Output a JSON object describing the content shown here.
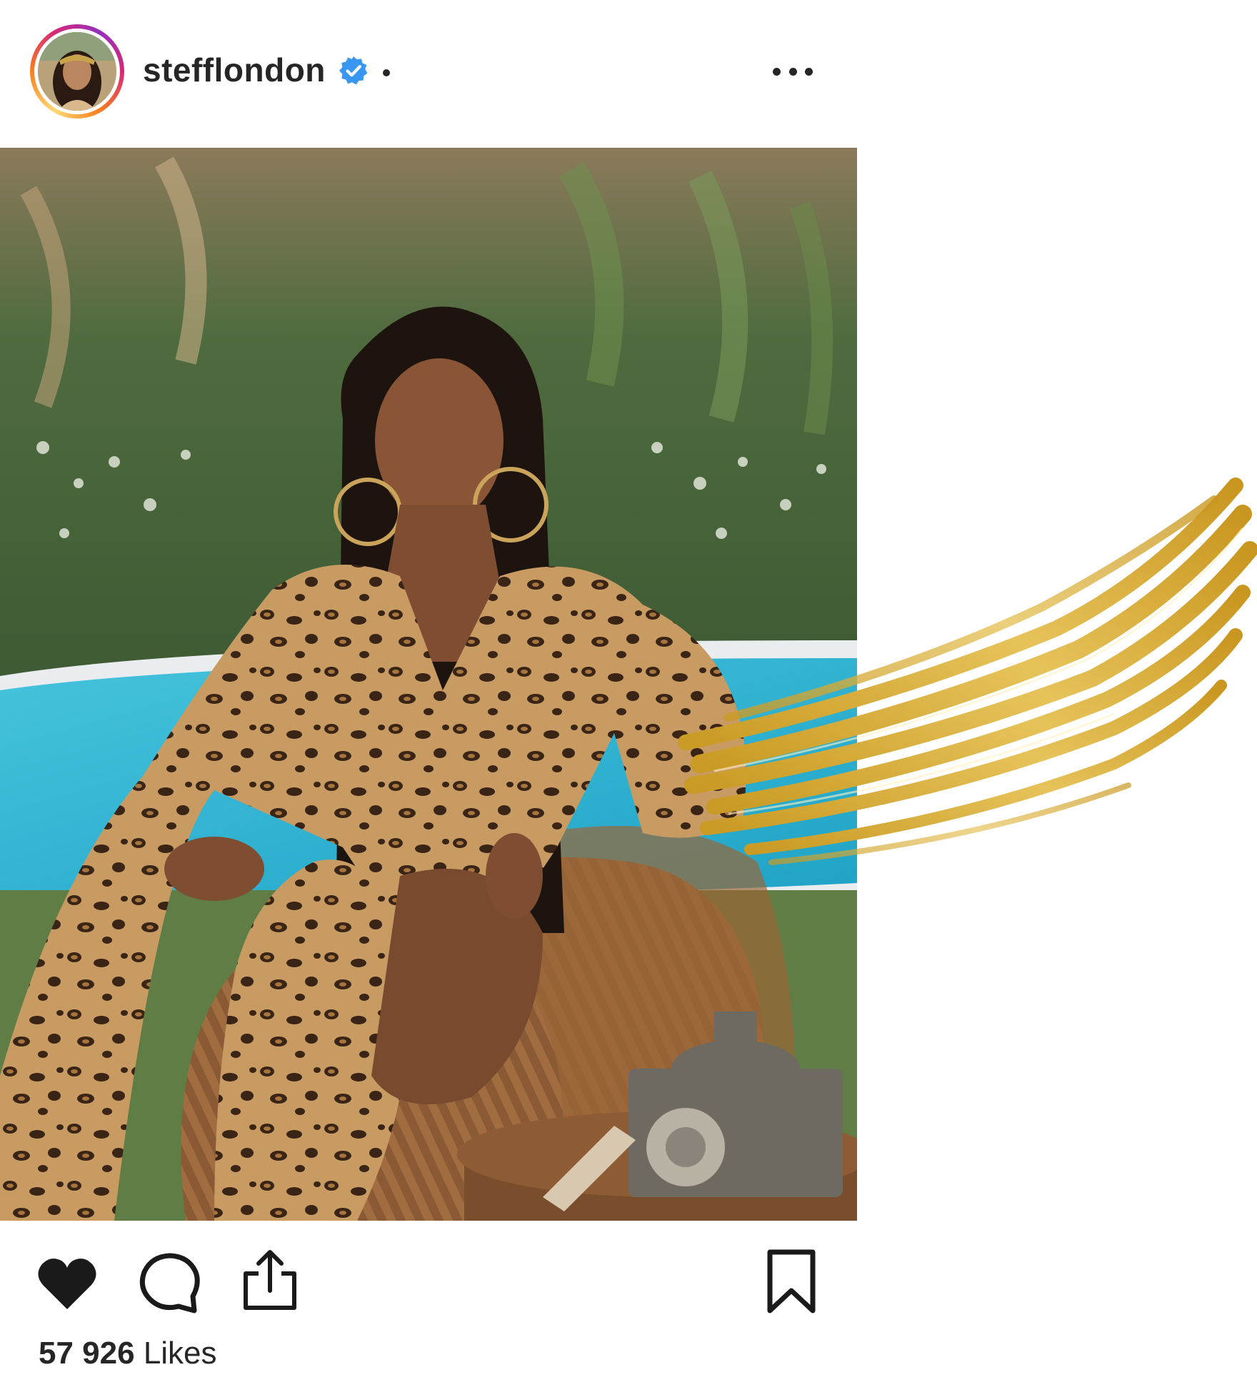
{
  "post": {
    "username": "stefflondon",
    "verified": true,
    "likes_count": "57 926",
    "likes_label": "Likes"
  },
  "icons": {
    "avatar": "profile-avatar",
    "verified": "verified-badge-icon",
    "more": "more-options-icon",
    "like": "heart-icon",
    "comment": "comment-icon",
    "share": "share-icon",
    "save": "bookmark-icon"
  },
  "colors": {
    "verified_blue": "#3897f0",
    "text": "#262626",
    "gold": "#d4a62a",
    "pool": "#2fb4d4",
    "foliage": "#4f6b3e"
  }
}
